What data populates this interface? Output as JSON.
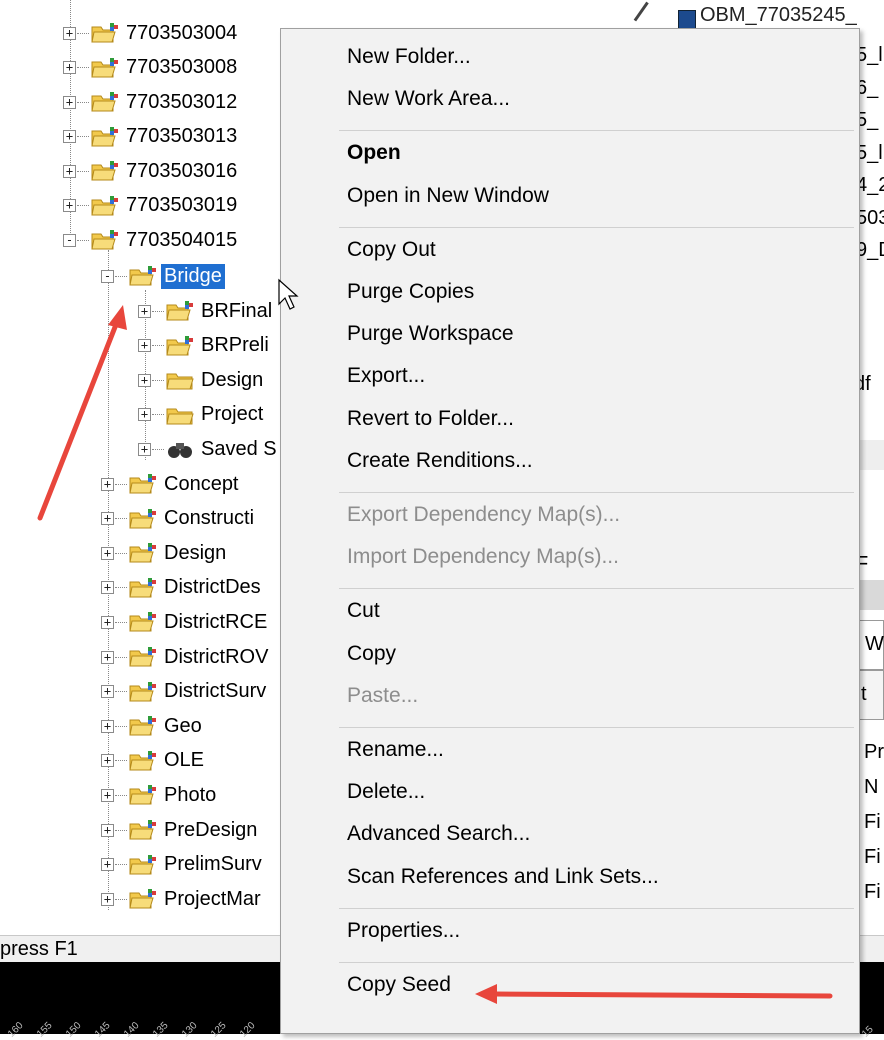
{
  "tree": {
    "top_items": [
      "7703503004",
      "7703503008",
      "7703503012",
      "7703503013",
      "7703503016",
      "7703503019",
      "7703504015"
    ],
    "selected": "Bridge",
    "bridge_children": [
      {
        "label": "BRFinal",
        "icon": "work-area-folder-icon"
      },
      {
        "label": "BRPreli",
        "icon": "work-area-folder-icon"
      },
      {
        "label": "Design",
        "icon": "folder-icon"
      },
      {
        "label": "Project",
        "icon": "folder-icon"
      },
      {
        "label": "Saved S",
        "icon": "binoculars-icon"
      }
    ],
    "siblings": [
      "Concept",
      "Constructi",
      "Design",
      "DistrictDes",
      "DistrictRCE",
      "DistrictROV",
      "DistrictSurv",
      "Geo",
      "OLE",
      "Photo",
      "PreDesign",
      "PrelimSurv",
      "ProjectMar"
    ]
  },
  "right_pane": {
    "top_text": "OBM_77035245_",
    "frags": [
      "5_l",
      "6_",
      "5_",
      "5_l",
      "4_2",
      "503",
      "9_D"
    ],
    "pdf_frag": "df",
    "frag_f": "F",
    "header_w": "W",
    "header_t": "t",
    "rows": [
      "Pr",
      "N",
      "Fi",
      "Fi",
      "Fi"
    ]
  },
  "status_bar": {
    "text": "press F1"
  },
  "ruler_ticks": [
    "160",
    "155",
    "150",
    "145",
    "140",
    "135",
    "130",
    "125",
    "120",
    "15"
  ],
  "context_menu": {
    "groups": [
      [
        {
          "label": "New Folder...",
          "state": "normal"
        },
        {
          "label": "New Work Area...",
          "state": "normal"
        }
      ],
      [
        {
          "label": "Open",
          "state": "bold"
        },
        {
          "label": "Open in New Window",
          "state": "normal"
        }
      ],
      [
        {
          "label": "Copy Out",
          "state": "normal"
        },
        {
          "label": "Purge Copies",
          "state": "normal"
        },
        {
          "label": "Purge Workspace",
          "state": "normal"
        },
        {
          "label": "Export...",
          "state": "normal"
        },
        {
          "label": "Revert to Folder...",
          "state": "normal"
        },
        {
          "label": "Create Renditions...",
          "state": "normal"
        }
      ],
      [
        {
          "label": "Export Dependency Map(s)...",
          "state": "disabled"
        },
        {
          "label": "Import Dependency Map(s)...",
          "state": "disabled"
        }
      ],
      [
        {
          "label": "Cut",
          "state": "normal"
        },
        {
          "label": "Copy",
          "state": "normal"
        },
        {
          "label": "Paste...",
          "state": "disabled"
        }
      ],
      [
        {
          "label": "Rename...",
          "state": "normal"
        },
        {
          "label": "Delete...",
          "state": "normal"
        },
        {
          "label": "Advanced Search...",
          "state": "normal"
        },
        {
          "label": "Scan References and Link Sets...",
          "state": "normal"
        }
      ],
      [
        {
          "label": "Properties...",
          "state": "normal"
        }
      ],
      [
        {
          "label": "Copy Seed",
          "state": "normal"
        }
      ]
    ]
  },
  "colors": {
    "selection": "#1f6fd1",
    "annotation_arrow": "#e8463c",
    "menu_bg": "#f2f2f2",
    "disabled_text": "#8d8d8d"
  }
}
